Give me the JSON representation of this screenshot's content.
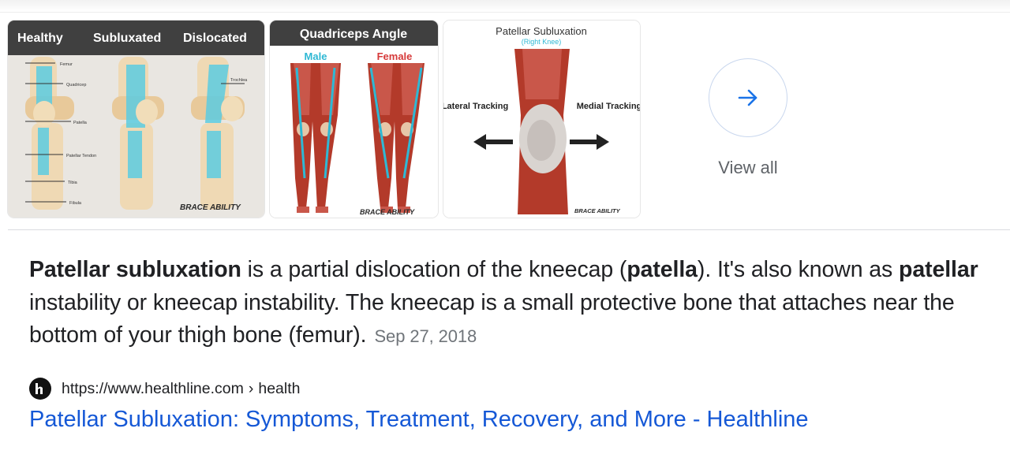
{
  "images": [
    {
      "labels": [
        "Healthy",
        "Subluxated",
        "Dislocated"
      ],
      "callouts": [
        "Femur",
        "Quadricep",
        "Patella",
        "Patellar Tendon",
        "Tibia",
        "Fibula",
        "Trochlea"
      ],
      "watermark": "BRACE ABILITY"
    },
    {
      "title": "Quadriceps Angle",
      "male_label": "Male",
      "female_label": "Female",
      "watermark": "BRACE ABILITY"
    },
    {
      "title": "Patellar Subluxation",
      "subtitle": "(Right Knee)",
      "left_label": "Lateral Tracking",
      "right_label": "Medial Tracking",
      "watermark": "BRACE ABILITY"
    }
  ],
  "view_all": {
    "label": "View all",
    "icon": "arrow-right-icon"
  },
  "snippet": {
    "parts": [
      {
        "text": "Patellar subluxation",
        "bold": true
      },
      {
        "text": " is a partial dislocation of the kneecap (",
        "bold": false
      },
      {
        "text": "patella",
        "bold": true
      },
      {
        "text": "). It's also known as ",
        "bold": false
      },
      {
        "text": "patellar",
        "bold": true
      },
      {
        "text": " instability or kneecap instability. The kneecap is a small protective bone that attaches near the bottom of your thigh bone (femur).",
        "bold": false
      }
    ],
    "date": "Sep 27, 2018"
  },
  "source": {
    "favicon": "healthline-h-icon",
    "url": "https://www.healthline.com",
    "separator": "›",
    "path": "health"
  },
  "result": {
    "title": "Patellar Subluxation: Symptoms, Treatment, Recovery, and More - Healthline"
  },
  "colors": {
    "link": "#1558d6",
    "accent_blue": "#1a73e8",
    "muted": "#5f6368",
    "dark_header": "#404040",
    "cyan": "#2fb8d4",
    "muscle_red": "#b33a2a"
  }
}
